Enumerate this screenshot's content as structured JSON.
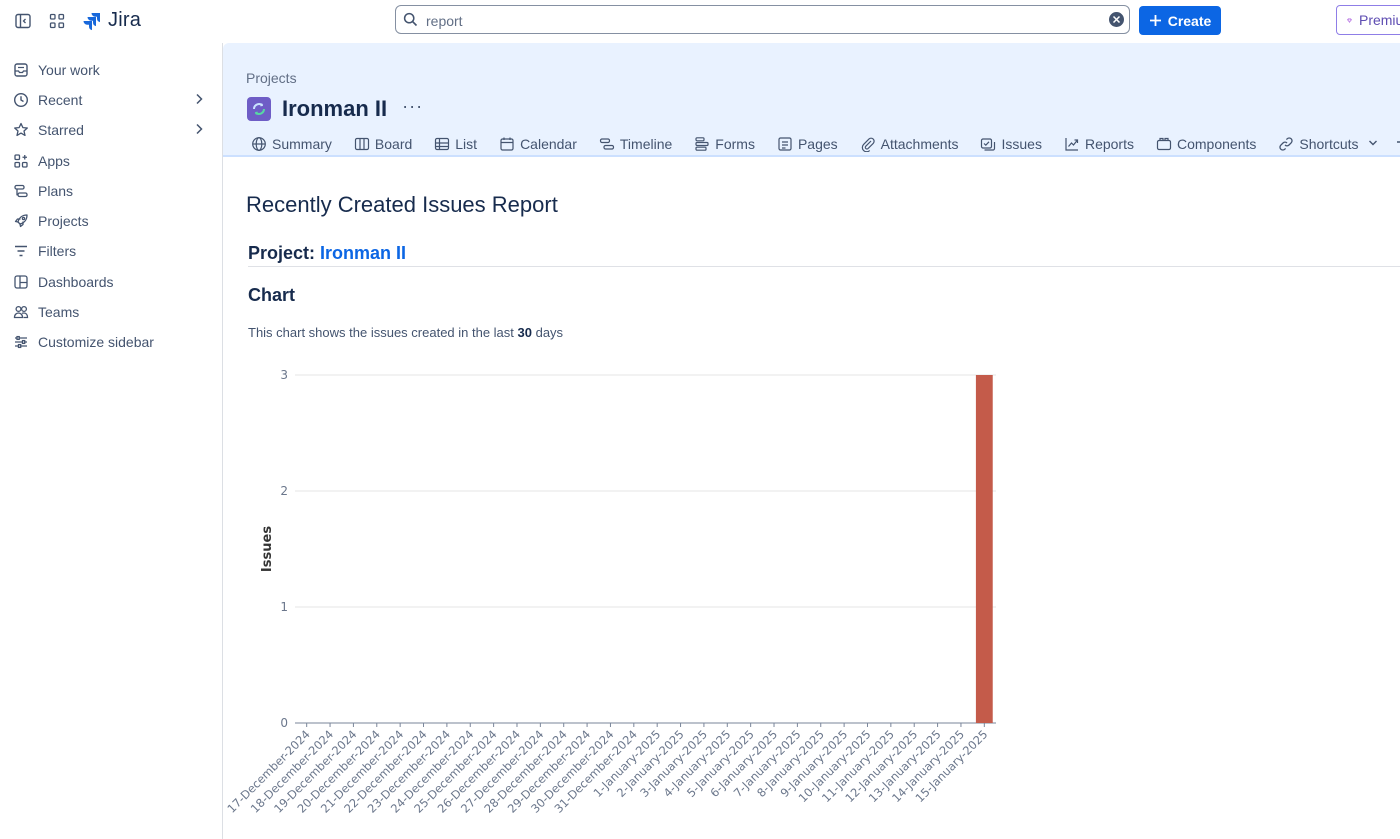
{
  "topbar": {
    "app_name": "Jira",
    "search_value": "report",
    "create_label": "Create",
    "premium_label": "Premium",
    "accent": "#0c66e4"
  },
  "sidebar": {
    "items": [
      {
        "label": "Your work",
        "icon": "inbox-icon",
        "chevron": false
      },
      {
        "label": "Recent",
        "icon": "clock-icon",
        "chevron": true
      },
      {
        "label": "Starred",
        "icon": "star-icon",
        "chevron": true
      },
      {
        "label": "Apps",
        "icon": "apps-icon",
        "chevron": false
      },
      {
        "label": "Plans",
        "icon": "plans-icon",
        "chevron": false
      },
      {
        "label": "Projects",
        "icon": "rocket-icon",
        "chevron": false
      },
      {
        "label": "Filters",
        "icon": "filter-icon",
        "chevron": false
      },
      {
        "label": "Dashboards",
        "icon": "dashboard-icon",
        "chevron": false
      },
      {
        "label": "Teams",
        "icon": "people-icon",
        "chevron": false
      },
      {
        "label": "Customize sidebar",
        "icon": "sliders-icon",
        "chevron": false
      }
    ]
  },
  "project": {
    "breadcrumb": "Projects",
    "name": "Ironman II",
    "more": "···",
    "tabs": [
      {
        "label": "Summary",
        "icon": "globe-icon"
      },
      {
        "label": "Board",
        "icon": "board-icon"
      },
      {
        "label": "List",
        "icon": "list-icon"
      },
      {
        "label": "Calendar",
        "icon": "calendar-icon"
      },
      {
        "label": "Timeline",
        "icon": "timeline-icon"
      },
      {
        "label": "Forms",
        "icon": "forms-icon"
      },
      {
        "label": "Pages",
        "icon": "pages-icon"
      },
      {
        "label": "Attachments",
        "icon": "paperclip-icon"
      },
      {
        "label": "Issues",
        "icon": "issues-icon"
      },
      {
        "label": "Reports",
        "icon": "reports-icon"
      },
      {
        "label": "Components",
        "icon": "components-icon"
      },
      {
        "label": "Shortcuts",
        "icon": "link-icon"
      }
    ]
  },
  "report": {
    "title": "Recently Created Issues Report",
    "project_label": "Project:",
    "project_name": "Ironman II",
    "chart_heading": "Chart",
    "desc_prefix": "This chart shows the issues created in the last ",
    "desc_days": "30",
    "desc_suffix": " days"
  },
  "chart_data": {
    "type": "bar",
    "title": "",
    "xlabel": "",
    "ylabel": "Issues",
    "ylim": [
      0,
      3
    ],
    "yticks": [
      "0",
      "1",
      "2",
      "3"
    ],
    "grid": true,
    "bar_color": "#c45b4a",
    "categories": [
      "17-December-2024",
      "18-December-2024",
      "19-December-2024",
      "20-December-2024",
      "21-December-2024",
      "22-December-2024",
      "23-December-2024",
      "24-December-2024",
      "25-December-2024",
      "26-December-2024",
      "27-December-2024",
      "28-December-2024",
      "29-December-2024",
      "30-December-2024",
      "31-December-2024",
      "1-January-2025",
      "2-January-2025",
      "3-January-2025",
      "4-January-2025",
      "5-January-2025",
      "6-January-2025",
      "7-January-2025",
      "8-January-2025",
      "9-January-2025",
      "10-January-2025",
      "11-January-2025",
      "12-January-2025",
      "13-January-2025",
      "14-January-2025",
      "15-January-2025"
    ],
    "values": [
      0,
      0,
      0,
      0,
      0,
      0,
      0,
      0,
      0,
      0,
      0,
      0,
      0,
      0,
      0,
      0,
      0,
      0,
      0,
      0,
      0,
      0,
      0,
      0,
      0,
      0,
      0,
      0,
      0,
      3
    ]
  }
}
